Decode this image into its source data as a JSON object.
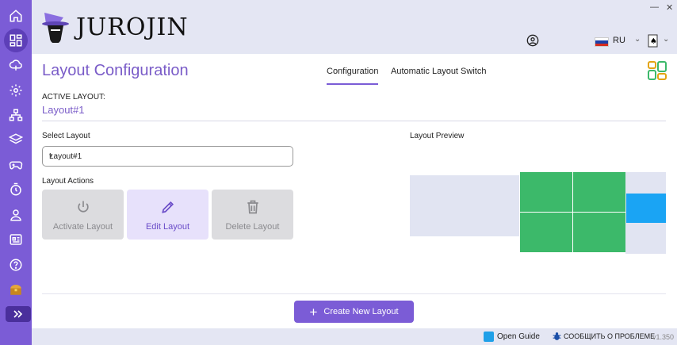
{
  "app": {
    "logo_text": "JUROJIN"
  },
  "window": {
    "minimize": "—",
    "close": "✕"
  },
  "header": {
    "language": "RU"
  },
  "page": {
    "title": "Layout Configuration",
    "tabs": [
      {
        "label": "Configuration",
        "active": true
      },
      {
        "label": "Automatic Layout Switch",
        "active": false
      }
    ],
    "active_layout_label": "ACTIVE LAYOUT:",
    "active_layout_value": "Layout#1",
    "select_label": "Select Layout",
    "select_value": "Layout#1",
    "actions_label": "Layout Actions",
    "actions": {
      "activate": "Activate Layout",
      "edit": "Edit Layout",
      "delete": "Delete Layout"
    },
    "preview_label": "Layout Preview",
    "create_button": "Create New Layout"
  },
  "footer": {
    "guide": "Open Guide",
    "report": "СООБЩИТЬ О ПРОБЛЕМЕ",
    "version": "v1.350"
  },
  "sidebar": {
    "items": [
      "home-icon",
      "dashboard-icon",
      "cloud-upload-icon",
      "settings-icon",
      "network-icon",
      "layers-icon",
      "gamepad-icon",
      "timer-icon",
      "user-icon",
      "news-icon",
      "help-icon",
      "treasure-chest-icon"
    ],
    "active": "dashboard-icon"
  },
  "colors": {
    "accent": "#7b5cd6",
    "green": "#3cb96a",
    "blue": "#1aa4f4",
    "panel": "#e1e4f2"
  }
}
